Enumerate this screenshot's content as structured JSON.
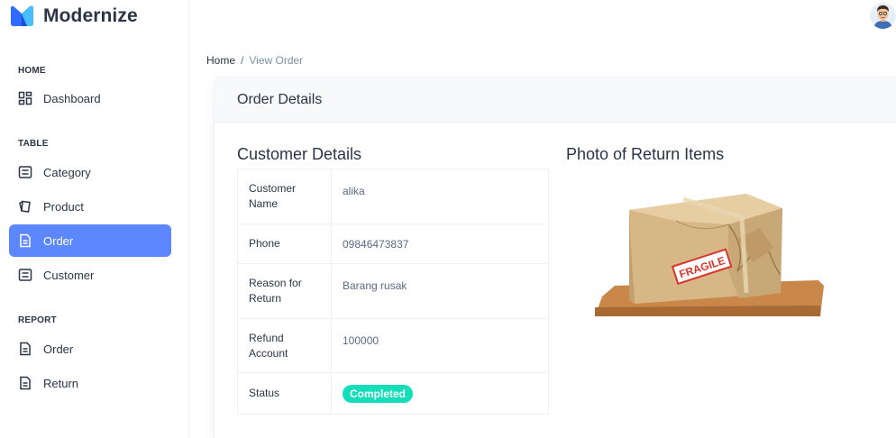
{
  "brand": {
    "name": "Modernize"
  },
  "sidebar": {
    "sections": [
      {
        "title": "HOME"
      },
      {
        "title": "TABLE"
      },
      {
        "title": "REPORT"
      }
    ],
    "items": [
      {
        "label": "Dashboard",
        "icon": "dashboard-icon"
      },
      {
        "label": "Category",
        "icon": "list-icon"
      },
      {
        "label": "Product",
        "icon": "cards-icon"
      },
      {
        "label": "Order",
        "icon": "file-icon",
        "active": true
      },
      {
        "label": "Customer",
        "icon": "list-icon"
      },
      {
        "label": "Order",
        "icon": "file-icon"
      },
      {
        "label": "Return",
        "icon": "file-icon"
      }
    ]
  },
  "breadcrumb": {
    "home": "Home",
    "separator": "/",
    "current": "View Order"
  },
  "card": {
    "title": "Order Details"
  },
  "customer": {
    "title": "Customer Details",
    "rows": [
      {
        "label": "Customer Name",
        "value": "alika"
      },
      {
        "label": "Phone",
        "value": "09846473837"
      },
      {
        "label": "Reason for Return",
        "value": "Barang rusak"
      },
      {
        "label": "Refund Account",
        "value": "100000"
      },
      {
        "label": "Status",
        "value": "Completed"
      }
    ]
  },
  "photo": {
    "title": "Photo of Return Items",
    "stamp_text": "FRAGILE"
  },
  "colors": {
    "primary": "#5d87ff",
    "success": "#13deb9",
    "text": "#2a3547",
    "muted": "#5a6a85"
  }
}
